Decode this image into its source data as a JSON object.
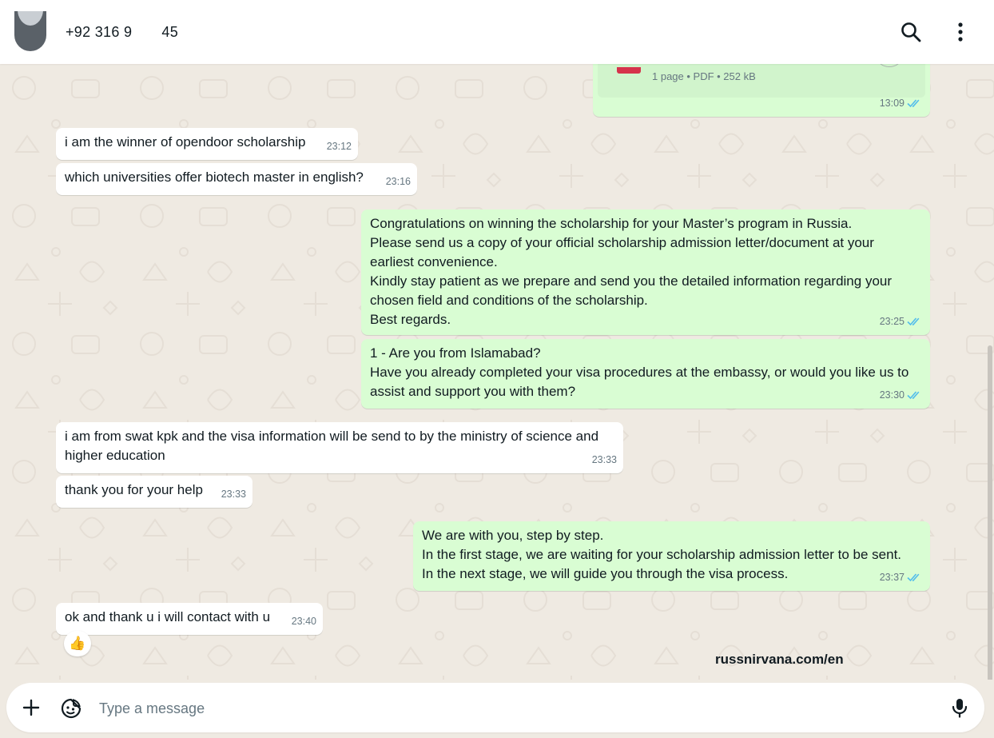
{
  "header": {
    "contact_name": "+92 316 9       45"
  },
  "pdf_message": {
    "meta": "1 page • PDF • 252 kB",
    "time": "13:09"
  },
  "messages": [
    {
      "dir": "in",
      "text": "i am the winner of opendoor scholarship",
      "time": "23:12"
    },
    {
      "dir": "in",
      "text": "which universities offer biotech master in english?",
      "time": "23:16"
    },
    {
      "dir": "out",
      "text": "Congratulations on winning the scholarship for your Master’s program in Russia.\nPlease send us a copy of your official scholarship admission letter/document at your earliest convenience.\nKindly stay patient as we prepare and send you the detailed information regarding your chosen field and conditions of the scholarship.\nBest regards.",
      "time": "23:25"
    },
    {
      "dir": "out",
      "text": "1 - Are you from Islamabad?\nHave you already completed your visa procedures at the embassy, or would you like us to assist and support you with them?",
      "time": "23:30"
    },
    {
      "dir": "in",
      "text": "i am from swat kpk and the visa information will be send to by the ministry of science and higher education",
      "time": "23:33"
    },
    {
      "dir": "in",
      "text": "thank you for your help",
      "time": "23:33"
    },
    {
      "dir": "out",
      "text": "We are with you, step by step.\nIn the first stage, we are waiting for your scholarship admission letter to be sent.\nIn the next stage, we will guide you through the visa process.",
      "time": "23:37"
    },
    {
      "dir": "in",
      "text": "ok and thank u i will contact with u",
      "time": "23:40"
    }
  ],
  "reaction": "👍",
  "watermark": "russnirvana.com/en",
  "composer": {
    "placeholder": "Type a message"
  },
  "icons": [
    "search-icon",
    "menu-icon",
    "plus-icon",
    "sticker-icon",
    "mic-icon",
    "double-check-icon",
    "thumbs-up-icon"
  ],
  "colors": {
    "outgoing_bubble": "#d9fdd3",
    "incoming_bubble": "#ffffff",
    "chat_background": "#efeae2",
    "read_tick": "#53bdeb"
  }
}
